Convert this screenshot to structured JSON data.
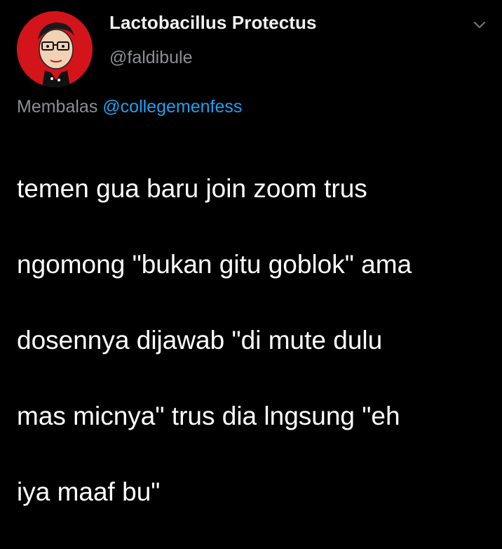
{
  "tweet": {
    "author": {
      "display_name": "Lactobacillus Protectus",
      "handle": "@faldibule",
      "avatar_icon": "cartoon-face-avatar"
    },
    "menu_icon": "chevron-down-icon",
    "reply": {
      "prefix": "Membalas",
      "mention": "@collegemenfess"
    },
    "text_lines": [
      "temen gua baru join zoom trus",
      "ngomong \"bukan gitu goblok\" ama",
      "dosennya dijawab \"di mute dulu",
      "mas micnya\" trus dia lngsung \"eh",
      "iya maaf bu\""
    ]
  },
  "colors": {
    "background": "#000000",
    "text": "#ffffff",
    "muted": "#8a8f94",
    "link": "#1da1f2",
    "avatar_bg": "#d3141a"
  }
}
